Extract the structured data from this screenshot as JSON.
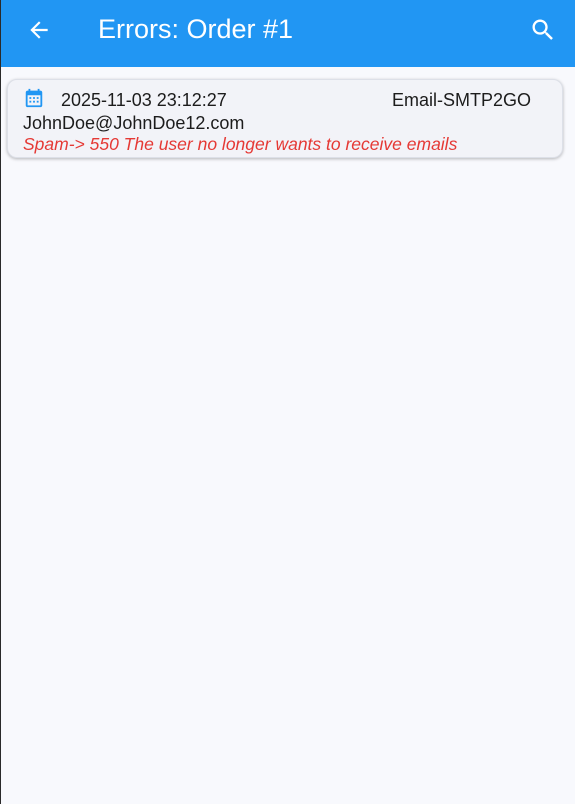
{
  "app_bar": {
    "title": "Errors: Order #1",
    "back_icon": "arrow-left-icon",
    "search_icon": "search-icon",
    "background_color": "#2196f3"
  },
  "errors": [
    {
      "icon": "calendar-icon",
      "timestamp": "2025-11-03 23:12:27",
      "channel": "Email-SMTP2GO",
      "recipient": "JohnDoe@JohnDoe12.com",
      "message": "Spam-> 550 The user no longer wants to receive emails",
      "message_color": "#e53935"
    }
  ]
}
